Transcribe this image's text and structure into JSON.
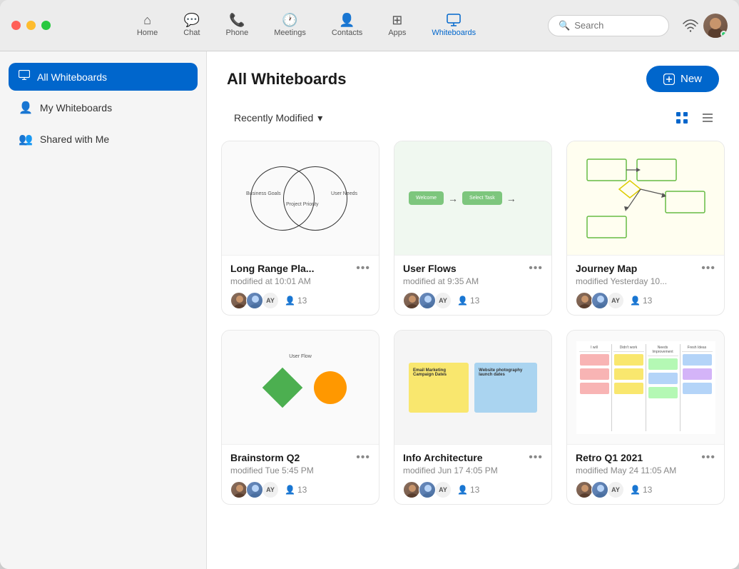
{
  "window": {
    "title": "Whiteboards"
  },
  "titlebar": {
    "controls": [
      "close",
      "minimize",
      "maximize"
    ],
    "nav_items": [
      {
        "id": "home",
        "label": "Home",
        "icon": "⌂"
      },
      {
        "id": "chat",
        "label": "Chat",
        "icon": "💬"
      },
      {
        "id": "phone",
        "label": "Phone",
        "icon": "📞"
      },
      {
        "id": "meetings",
        "label": "Meetings",
        "icon": "🕐"
      },
      {
        "id": "contacts",
        "label": "Contacts",
        "icon": "👤"
      },
      {
        "id": "apps",
        "label": "Apps",
        "icon": "⊞"
      },
      {
        "id": "whiteboards",
        "label": "Whiteboards",
        "icon": "□",
        "active": true
      }
    ],
    "search": {
      "placeholder": "Search"
    }
  },
  "sidebar": {
    "items": [
      {
        "id": "all",
        "label": "All Whiteboards",
        "icon": "⬜",
        "active": true
      },
      {
        "id": "my",
        "label": "My Whiteboards",
        "icon": "👤"
      },
      {
        "id": "shared",
        "label": "Shared with Me",
        "icon": "👥"
      }
    ]
  },
  "content": {
    "title": "All Whiteboards",
    "new_button": "New",
    "filter": {
      "label": "Recently Modified",
      "chevron": "▾"
    },
    "view_grid_label": "Grid view",
    "view_list_label": "List view",
    "whiteboards": [
      {
        "id": "wb1",
        "title": "Long Range Pla...",
        "modified": "modified at 10:01 AM",
        "type": "venn",
        "collaborators": [
          "av1",
          "av2",
          "AY",
          "icon"
        ],
        "count": "13"
      },
      {
        "id": "wb2",
        "title": "User Flows",
        "modified": "modified at 9:35 AM",
        "type": "flow",
        "collaborators": [
          "av1",
          "av2",
          "AY",
          "icon"
        ],
        "count": "13"
      },
      {
        "id": "wb3",
        "title": "Journey Map",
        "modified": "modified Yesterday 10...",
        "type": "journey",
        "collaborators": [
          "av1",
          "av2",
          "AY",
          "icon"
        ],
        "count": "13"
      },
      {
        "id": "wb4",
        "title": "Brainstorm Q2",
        "modified": "modified Tue 5:45 PM",
        "type": "brainstorm",
        "collaborators": [
          "av1",
          "av2",
          "AY",
          "icon"
        ],
        "count": "13"
      },
      {
        "id": "wb5",
        "title": "Info Architecture",
        "modified": "modified Jun 17 4:05 PM",
        "type": "ia",
        "collaborators": [
          "av1",
          "av2",
          "AY",
          "icon"
        ],
        "count": "13"
      },
      {
        "id": "wb6",
        "title": "Retro Q1 2021",
        "modified": "modified May 24 11:05 AM",
        "type": "retro",
        "collaborators": [
          "av1",
          "av2",
          "AY",
          "icon"
        ],
        "count": "13"
      }
    ]
  }
}
